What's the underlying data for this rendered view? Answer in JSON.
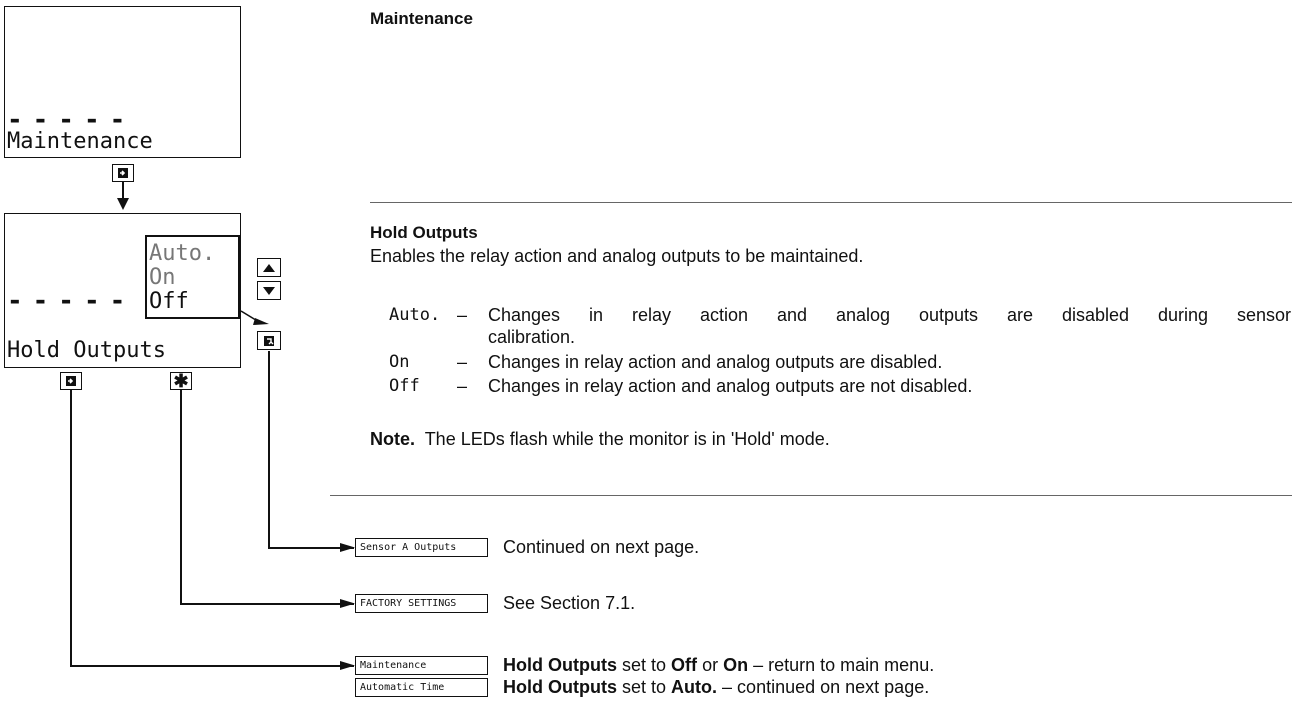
{
  "diagram": {
    "maintenance_screen": {
      "label": "Maintenance",
      "dashes": "-----"
    },
    "hold_screen": {
      "label": "Hold Outputs",
      "dashes": "-----",
      "options": [
        "Auto.",
        "On",
        "Off"
      ]
    },
    "keys": {
      "enter": "enter-key",
      "star": "star-key",
      "up": "up-arrow-key",
      "down": "down-arrow-key",
      "advance": "advance-key"
    },
    "tags": {
      "sensor": "Sensor A Outputs",
      "factory": "FACTORY SETTINGS",
      "maintenance": "Maintenance",
      "automatic": "Automatic Time"
    }
  },
  "text": {
    "maintenance_heading": "Maintenance",
    "hold_heading": "Hold Outputs",
    "hold_desc": "Enables the relay action and analog outputs to be maintained.",
    "options": [
      {
        "code": "Auto.",
        "dash": "–",
        "line1": "Changes in relay action and analog outputs are disabled during sensor",
        "line2": "calibration."
      },
      {
        "code": "On",
        "dash": "–",
        "line1": "Changes in relay action and analog outputs are disabled."
      },
      {
        "code": "Off",
        "dash": "–",
        "line1": "Changes in relay action and analog outputs are not disabled."
      }
    ],
    "note_label": "Note.",
    "note_text": "The LEDs flash while the monitor is in 'Hold' mode.",
    "continued": "Continued on next page.",
    "see_section": "See Section 7.1.",
    "return_line": {
      "kw1": "Hold Outputs",
      "t1": "set to",
      "kw2": "Off",
      "t2": "or",
      "kw3": "On",
      "t3": "– return to main menu."
    },
    "auto_line": {
      "kw1": "Hold Outputs",
      "t1": "set to",
      "kw2": "Auto.",
      "t2": "– continued on next page."
    }
  }
}
